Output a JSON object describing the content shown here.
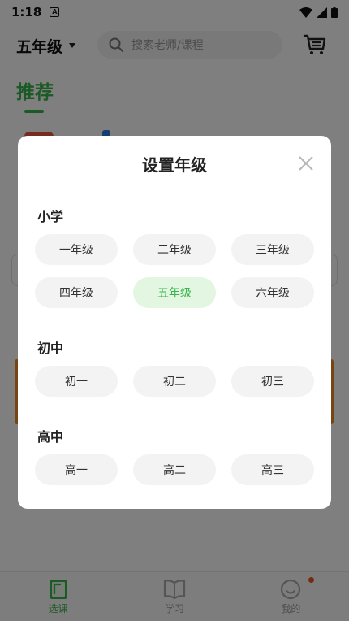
{
  "status_bar": {
    "time": "1:18",
    "notification_letter": "A"
  },
  "header": {
    "grade": "五年级",
    "search_placeholder": "搜索老师/课程"
  },
  "tabs": {
    "recommend": "推荐"
  },
  "bottom_nav": [
    {
      "label": "选课",
      "icon": "course-book-icon",
      "active": true
    },
    {
      "label": "学习",
      "icon": "open-book-icon",
      "active": false
    },
    {
      "label": "我的",
      "icon": "smiley-face-icon",
      "active": false
    }
  ],
  "dialog": {
    "title": "设置年级",
    "sections": [
      {
        "title": "小学",
        "grades": [
          "一年级",
          "二年级",
          "三年级",
          "四年级",
          "五年级",
          "六年级"
        ]
      },
      {
        "title": "初中",
        "grades": [
          "初一",
          "初二",
          "初三"
        ]
      },
      {
        "title": "高中",
        "grades": [
          "高一",
          "高二",
          "高三"
        ]
      }
    ],
    "selected_grade": "五年级"
  },
  "colors": {
    "accent": "#39b54a",
    "selected_bg": "#e3f6e1",
    "button_bg": "#f3f3f3",
    "badge": "#e8591f"
  }
}
